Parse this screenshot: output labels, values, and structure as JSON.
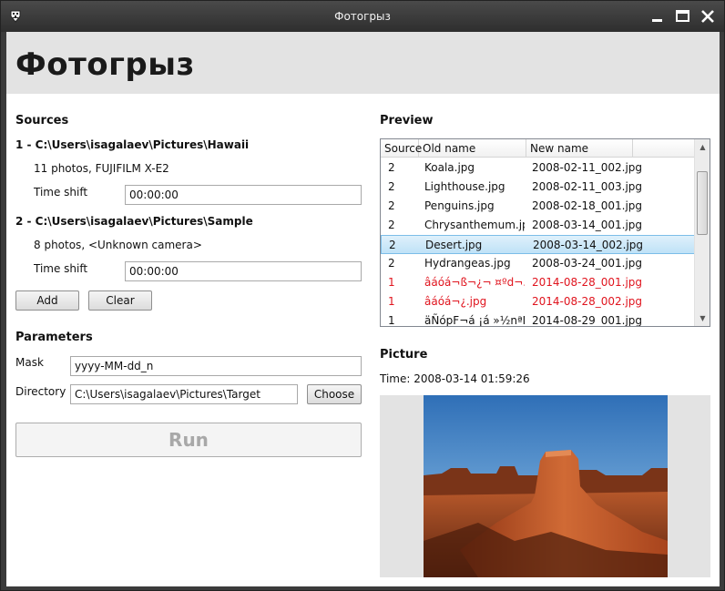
{
  "window": {
    "title": "Фотогрыз"
  },
  "header": {
    "title": "Фотогрыз"
  },
  "sources": {
    "title": "Sources",
    "items": [
      {
        "heading": "1 - C:\\Users\\isagalaev\\Pictures\\Hawaii",
        "info": "11 photos, FUJIFILM X-E2",
        "shift_label": "Time shift",
        "shift_value": "00:00:00"
      },
      {
        "heading": "2 - C:\\Users\\isagalaev\\Pictures\\Sample",
        "info": "8 photos, <Unknown camera>",
        "shift_label": "Time shift",
        "shift_value": "00:00:00"
      }
    ],
    "add_label": "Add",
    "clear_label": "Clear"
  },
  "parameters": {
    "title": "Parameters",
    "mask_label": "Mask",
    "mask_value": "yyyy-MM-dd_n",
    "directory_label": "Directory",
    "directory_value": "C:\\Users\\isagalaev\\Pictures\\Target",
    "choose_label": "Choose",
    "run_label": "Run"
  },
  "preview": {
    "title": "Preview",
    "columns": [
      "Source",
      "Old name",
      "New name"
    ],
    "rows": [
      {
        "source": "2",
        "old": "Koala.jpg",
        "new": "2008-02-11_002.jpg",
        "state": "normal"
      },
      {
        "source": "2",
        "old": "Lighthouse.jpg",
        "new": "2008-02-11_003.jpg",
        "state": "normal"
      },
      {
        "source": "2",
        "old": "Penguins.jpg",
        "new": "2008-02-18_001.jpg",
        "state": "normal"
      },
      {
        "source": "2",
        "old": "Chrysanthemum.jpg",
        "new": "2008-03-14_001.jpg",
        "state": "normal"
      },
      {
        "source": "2",
        "old": "Desert.jpg",
        "new": "2008-03-14_002.jpg",
        "state": "selected"
      },
      {
        "source": "2",
        "old": "Hydrangeas.jpg",
        "new": "2008-03-24_001.jpg",
        "state": "normal"
      },
      {
        "source": "1",
        "old": "âáóá¬ß¬¿¬ ¤ºd¬.jp",
        "new": "2014-08-28_001.jpg",
        "state": "error"
      },
      {
        "source": "1",
        "old": "âáóá¬¿.jpg",
        "new": "2014-08-28_002.jpg",
        "state": "error"
      },
      {
        "source": "1",
        "old": "äÑópF¬á ¡á »½nªÑ.",
        "new": "2014-08-29_001.jpg",
        "state": "normal"
      }
    ],
    "scroll_position": 0.17
  },
  "picture": {
    "title": "Picture",
    "time_label": "Time: 2008-03-14 01:59:26"
  },
  "colors": {
    "error": "#e0141e",
    "selection": "#bfe2f7",
    "header_bg": "#e3e3e3"
  },
  "icons": [
    "app-icon",
    "minimize-icon",
    "maximize-icon",
    "close-icon"
  ]
}
